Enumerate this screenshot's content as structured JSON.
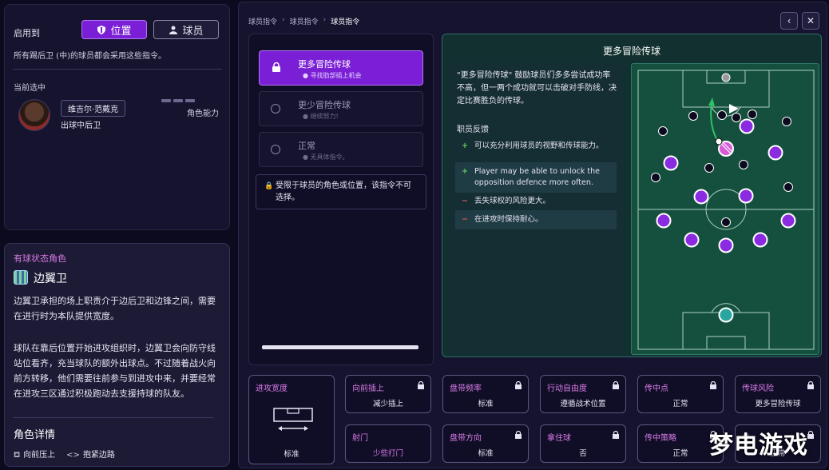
{
  "left": {
    "apply_label": "启用到",
    "toggle_position": "位置",
    "toggle_player": "球员",
    "apply_desc": "所有踢后卫 (中)的球员都会采用这些指令。",
    "current_label": "当前选中",
    "player_name": "维吉尔·范戴克",
    "player_role": "出球中后卫",
    "ability_label": "角色能力"
  },
  "role": {
    "header": "有球状态角色",
    "name": "边翼卫",
    "para1": "边翼卫承担的场上职责介于边后卫和边锋之间，需要在进行时为本队提供宽度。",
    "para2": "球队在靠后位置开始进攻组织时，边翼卫会向防守线站位看齐，充当球队的额外出球点。不过随着战火向前方转移，他们需要往前参与到进攻中来，并要经常在进攻三区通过积极跑动去支援持球的队友。",
    "detail_title": "角色详情",
    "tag1": "向前压上",
    "tag2": "抱紧边路"
  },
  "breadcrumb": [
    "球员指令",
    "球员指令",
    "球员指令"
  ],
  "options": [
    {
      "label": "更多冒险传球",
      "sub": "寻找肋部插上机会",
      "selected": true
    },
    {
      "label": "更少冒险传球",
      "sub": "继续努力!",
      "selected": false
    },
    {
      "label": "正常",
      "sub": "无具体指令。",
      "selected": false
    }
  ],
  "restrict_text": "受限于球员的角色或位置，该指令不可选择。",
  "detail": {
    "title": "更多冒险传球",
    "desc": "\"更多冒险传球\" 鼓励球员们多多尝试成功率不高，但一两个成功就可以击破对手防线，决定比赛胜负的传球。",
    "feedback_title": "职员反馈",
    "feedback": [
      {
        "sign": "+",
        "text": "可以充分利用球员的视野和传球能力。"
      },
      {
        "sign": "+",
        "text": "Player may be able to unlock the opposition defence more often."
      },
      {
        "sign": "−",
        "text": "丢失球权的风险更大。"
      },
      {
        "sign": "−",
        "text": "在进攻时保持耐心。"
      }
    ]
  },
  "tiles": [
    {
      "title": "进攻宽度",
      "value": "标准",
      "locked": false
    },
    {
      "title": "向前插上",
      "value": "减少插上",
      "locked": true
    },
    {
      "title": "盘带频率",
      "value": "标准",
      "locked": true
    },
    {
      "title": "行动自由度",
      "value": "遵循战术位置",
      "locked": true
    },
    {
      "title": "传中点",
      "value": "正常",
      "locked": true
    },
    {
      "title": "传球风险",
      "value": "更多冒险传球",
      "locked": true
    },
    {
      "title": "射门",
      "value": "少些打门",
      "locked": false
    },
    {
      "title": "盘带方向",
      "value": "标准",
      "locked": true
    },
    {
      "title": "拿住球",
      "value": "否",
      "locked": true
    },
    {
      "title": "传中策略",
      "value": "正常",
      "locked": true
    },
    {
      "title": "传",
      "value": "正常",
      "locked": true
    }
  ],
  "watermark": "梦电游戏",
  "colors": {
    "accent": "#7a1fd6",
    "pink": "#d77ae6",
    "pitch": "#15503f"
  }
}
